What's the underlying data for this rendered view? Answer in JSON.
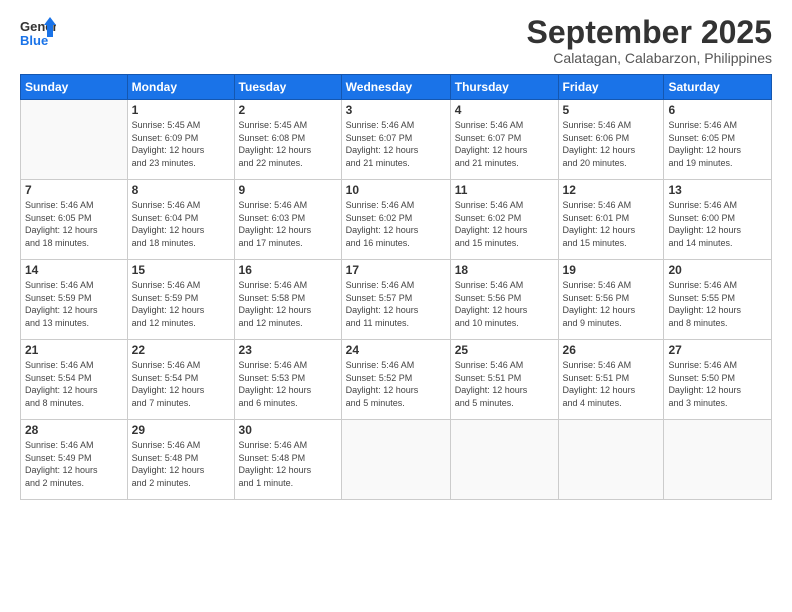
{
  "logo": {
    "line1": "General",
    "line2": "Blue"
  },
  "title": "September 2025",
  "location": "Calatagan, Calabarzon, Philippines",
  "days_header": [
    "Sunday",
    "Monday",
    "Tuesday",
    "Wednesday",
    "Thursday",
    "Friday",
    "Saturday"
  ],
  "weeks": [
    [
      {
        "day": "",
        "info": ""
      },
      {
        "day": "1",
        "info": "Sunrise: 5:45 AM\nSunset: 6:09 PM\nDaylight: 12 hours\nand 23 minutes."
      },
      {
        "day": "2",
        "info": "Sunrise: 5:45 AM\nSunset: 6:08 PM\nDaylight: 12 hours\nand 22 minutes."
      },
      {
        "day": "3",
        "info": "Sunrise: 5:46 AM\nSunset: 6:07 PM\nDaylight: 12 hours\nand 21 minutes."
      },
      {
        "day": "4",
        "info": "Sunrise: 5:46 AM\nSunset: 6:07 PM\nDaylight: 12 hours\nand 21 minutes."
      },
      {
        "day": "5",
        "info": "Sunrise: 5:46 AM\nSunset: 6:06 PM\nDaylight: 12 hours\nand 20 minutes."
      },
      {
        "day": "6",
        "info": "Sunrise: 5:46 AM\nSunset: 6:05 PM\nDaylight: 12 hours\nand 19 minutes."
      }
    ],
    [
      {
        "day": "7",
        "info": "Sunrise: 5:46 AM\nSunset: 6:05 PM\nDaylight: 12 hours\nand 18 minutes."
      },
      {
        "day": "8",
        "info": "Sunrise: 5:46 AM\nSunset: 6:04 PM\nDaylight: 12 hours\nand 18 minutes."
      },
      {
        "day": "9",
        "info": "Sunrise: 5:46 AM\nSunset: 6:03 PM\nDaylight: 12 hours\nand 17 minutes."
      },
      {
        "day": "10",
        "info": "Sunrise: 5:46 AM\nSunset: 6:02 PM\nDaylight: 12 hours\nand 16 minutes."
      },
      {
        "day": "11",
        "info": "Sunrise: 5:46 AM\nSunset: 6:02 PM\nDaylight: 12 hours\nand 15 minutes."
      },
      {
        "day": "12",
        "info": "Sunrise: 5:46 AM\nSunset: 6:01 PM\nDaylight: 12 hours\nand 15 minutes."
      },
      {
        "day": "13",
        "info": "Sunrise: 5:46 AM\nSunset: 6:00 PM\nDaylight: 12 hours\nand 14 minutes."
      }
    ],
    [
      {
        "day": "14",
        "info": "Sunrise: 5:46 AM\nSunset: 5:59 PM\nDaylight: 12 hours\nand 13 minutes."
      },
      {
        "day": "15",
        "info": "Sunrise: 5:46 AM\nSunset: 5:59 PM\nDaylight: 12 hours\nand 12 minutes."
      },
      {
        "day": "16",
        "info": "Sunrise: 5:46 AM\nSunset: 5:58 PM\nDaylight: 12 hours\nand 12 minutes."
      },
      {
        "day": "17",
        "info": "Sunrise: 5:46 AM\nSunset: 5:57 PM\nDaylight: 12 hours\nand 11 minutes."
      },
      {
        "day": "18",
        "info": "Sunrise: 5:46 AM\nSunset: 5:56 PM\nDaylight: 12 hours\nand 10 minutes."
      },
      {
        "day": "19",
        "info": "Sunrise: 5:46 AM\nSunset: 5:56 PM\nDaylight: 12 hours\nand 9 minutes."
      },
      {
        "day": "20",
        "info": "Sunrise: 5:46 AM\nSunset: 5:55 PM\nDaylight: 12 hours\nand 8 minutes."
      }
    ],
    [
      {
        "day": "21",
        "info": "Sunrise: 5:46 AM\nSunset: 5:54 PM\nDaylight: 12 hours\nand 8 minutes."
      },
      {
        "day": "22",
        "info": "Sunrise: 5:46 AM\nSunset: 5:54 PM\nDaylight: 12 hours\nand 7 minutes."
      },
      {
        "day": "23",
        "info": "Sunrise: 5:46 AM\nSunset: 5:53 PM\nDaylight: 12 hours\nand 6 minutes."
      },
      {
        "day": "24",
        "info": "Sunrise: 5:46 AM\nSunset: 5:52 PM\nDaylight: 12 hours\nand 5 minutes."
      },
      {
        "day": "25",
        "info": "Sunrise: 5:46 AM\nSunset: 5:51 PM\nDaylight: 12 hours\nand 5 minutes."
      },
      {
        "day": "26",
        "info": "Sunrise: 5:46 AM\nSunset: 5:51 PM\nDaylight: 12 hours\nand 4 minutes."
      },
      {
        "day": "27",
        "info": "Sunrise: 5:46 AM\nSunset: 5:50 PM\nDaylight: 12 hours\nand 3 minutes."
      }
    ],
    [
      {
        "day": "28",
        "info": "Sunrise: 5:46 AM\nSunset: 5:49 PM\nDaylight: 12 hours\nand 2 minutes."
      },
      {
        "day": "29",
        "info": "Sunrise: 5:46 AM\nSunset: 5:48 PM\nDaylight: 12 hours\nand 2 minutes."
      },
      {
        "day": "30",
        "info": "Sunrise: 5:46 AM\nSunset: 5:48 PM\nDaylight: 12 hours\nand 1 minute."
      },
      {
        "day": "",
        "info": ""
      },
      {
        "day": "",
        "info": ""
      },
      {
        "day": "",
        "info": ""
      },
      {
        "day": "",
        "info": ""
      }
    ]
  ]
}
